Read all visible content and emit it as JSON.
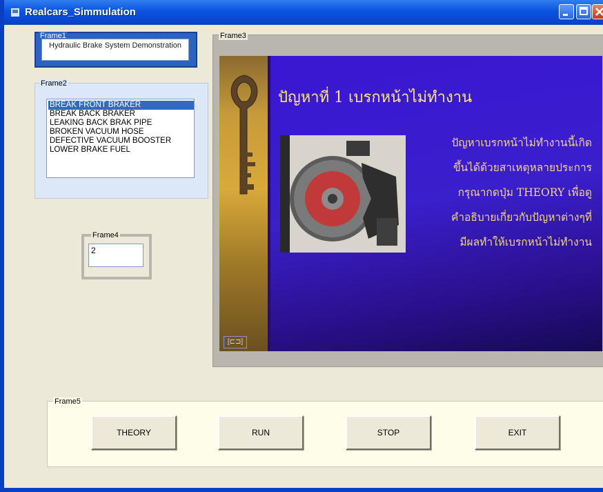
{
  "window": {
    "title": "Realcars_Simmulation"
  },
  "frame1": {
    "label": "Frame1",
    "text": "Hydraulic Brake System Demonstration"
  },
  "frame2": {
    "label": "Frame2",
    "items": [
      {
        "label": "BREAK FRONT BRAKER",
        "selected": true
      },
      {
        "label": "BREAK BACK BRAKER",
        "selected": false
      },
      {
        "label": "LEAKING BACK BRAK PIPE",
        "selected": false
      },
      {
        "label": "BROKEN VACUUM HOSE",
        "selected": false
      },
      {
        "label": "DEFECTIVE VACUUM BOOSTER",
        "selected": false
      },
      {
        "label": "LOWER BRAKE FUEL",
        "selected": false
      }
    ]
  },
  "frame3": {
    "label": "Frame3",
    "slide": {
      "title": "ปัญหาที่ 1 เบรกหน้าไม่ทำงาน",
      "lines": [
        "ปัญหาเบรกหน้าไม่ทำงานนี้เกิด",
        "ขึ้นได้ด้วยสาเหตุหลายประการ",
        "กรุณากดปุ่ม THEORY เพื่อดู",
        "คำอธิบายเกี่ยวกับปัญหาต่างๆที่",
        "มีผลทำให้เบรกหน้าไม่ทำงาน"
      ],
      "control": "[⊏⊐]"
    }
  },
  "frame4": {
    "label": "Frame4",
    "value": "2"
  },
  "frame5": {
    "label": "Frame5",
    "buttons": {
      "theory": "THEORY",
      "run": "RUN",
      "stop": "STOP",
      "exit": "EXIT"
    }
  },
  "icons": {
    "app": "app-icon",
    "minimize": "minimize-icon",
    "maximize": "maximize-icon",
    "close": "close-icon"
  },
  "colors": {
    "titlebar": "#0b53e0",
    "selection": "#316ac5",
    "slide_bg": "#3a16d2",
    "slide_text": "#f3d487"
  }
}
